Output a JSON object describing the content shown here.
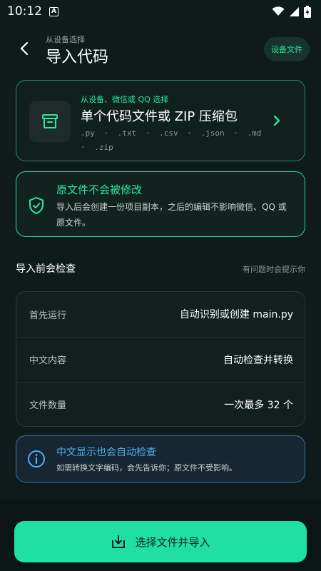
{
  "status": {
    "time": "10:12",
    "a_badge": "A"
  },
  "header": {
    "subtitle": "从设备选择",
    "title": "导入代码",
    "device_button": "设备文件"
  },
  "main_card": {
    "kicker": "从设备、微信或 QQ 选择",
    "title": "单个代码文件或 ZIP 压缩包",
    "extensions": [
      ".py",
      "·",
      ".txt",
      "·",
      ".csv",
      "·",
      ".json",
      "·",
      ".md",
      "·",
      ".zip"
    ]
  },
  "safe_card": {
    "title": "原文件不会被修改",
    "description": "导入后会创建一份项目副本，之后的编辑不影响微信、QQ 或原文件。"
  },
  "checks": {
    "heading": "导入前会检查",
    "hint": "有问题时会提示你",
    "rows": [
      {
        "label": "首先运行",
        "value": "自动识别或创建 main.py"
      },
      {
        "label": "中文内容",
        "value": "自动检查并转换"
      },
      {
        "label": "文件数量",
        "value": "一次最多 32 个"
      }
    ]
  },
  "info_card": {
    "title": "中文显示也会自动检查",
    "description": "如需转换文字编码，会先告诉你；原文件不受影响。"
  },
  "cta": {
    "label": "选择文件并导入"
  },
  "colors": {
    "accent": "#1fe0a0",
    "accent_text": "#2ee6a0",
    "info": "#4eb2ef",
    "background": "#0f1a1a"
  },
  "icons": {
    "back": "chevron-left-icon",
    "archive": "archive-box-icon",
    "chevron": "chevron-right-icon",
    "shield": "shield-check-icon",
    "info": "info-circle-icon",
    "download": "download-tray-icon"
  }
}
